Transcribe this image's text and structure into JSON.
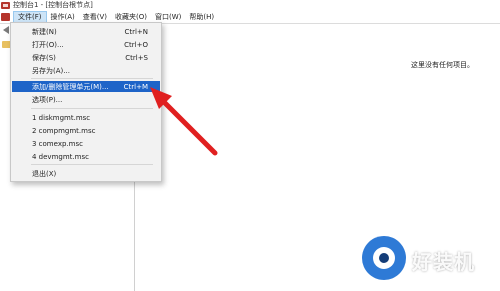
{
  "window": {
    "title": "控制台1 - [控制台根节点]"
  },
  "menubar": {
    "items": [
      {
        "label": "文件(F)"
      },
      {
        "label": "操作(A)"
      },
      {
        "label": "查看(V)"
      },
      {
        "label": "收藏夹(O)"
      },
      {
        "label": "窗口(W)"
      },
      {
        "label": "帮助(H)"
      }
    ]
  },
  "file_menu": {
    "items": [
      {
        "label": "新建(N)",
        "shortcut": "Ctrl+N"
      },
      {
        "label": "打开(O)...",
        "shortcut": "Ctrl+O"
      },
      {
        "label": "保存(S)",
        "shortcut": "Ctrl+S"
      },
      {
        "label": "另存为(A)...",
        "shortcut": ""
      },
      {
        "label": "添加/删除管理单元(M)...",
        "shortcut": "Ctrl+M",
        "highlighted": true
      },
      {
        "label": "选项(P)...",
        "shortcut": ""
      },
      {
        "label": "1 diskmgmt.msc",
        "shortcut": ""
      },
      {
        "label": "2 compmgmt.msc",
        "shortcut": ""
      },
      {
        "label": "3 comexp.msc",
        "shortcut": ""
      },
      {
        "label": "4 devmgmt.msc",
        "shortcut": ""
      },
      {
        "label": "退出(X)",
        "shortcut": ""
      }
    ]
  },
  "main": {
    "empty_message": "这里没有任何项目。"
  },
  "watermark": {
    "text": "好装机"
  },
  "colors": {
    "highlight": "#1e64c8",
    "arrow": "#e02020",
    "watermark_blue": "#2e7ad6"
  }
}
